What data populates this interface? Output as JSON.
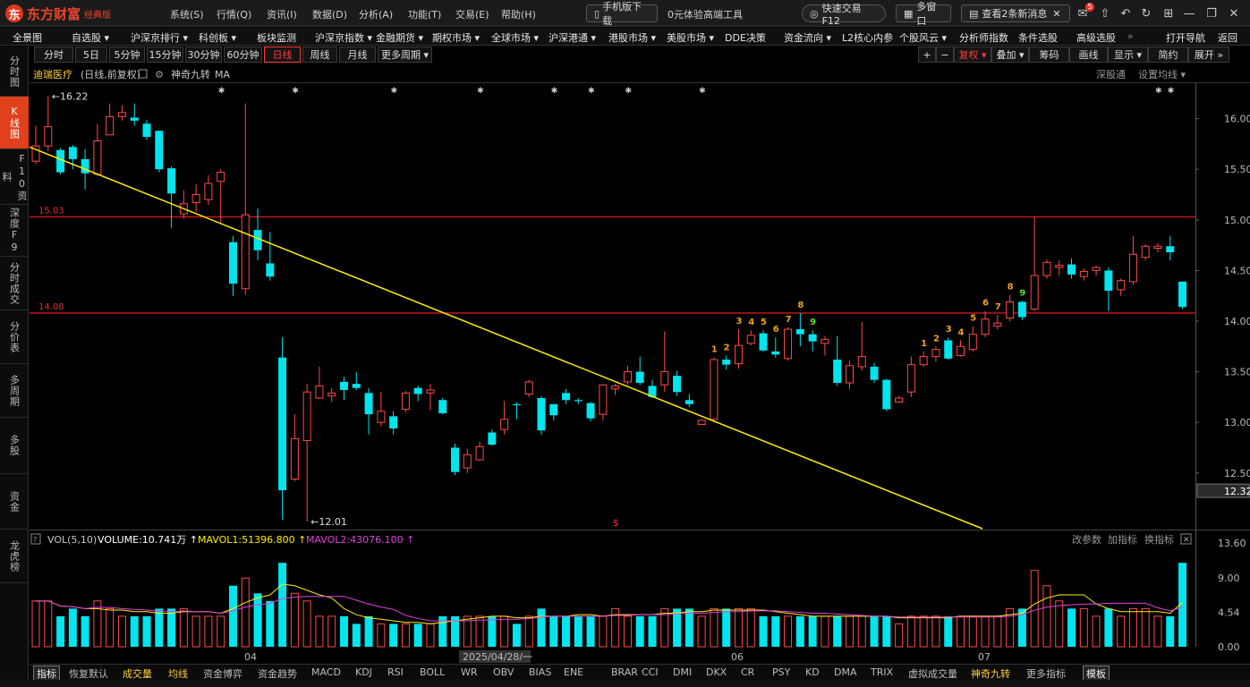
{
  "app": {
    "logo_text": "东方财富",
    "edition": "经典版",
    "menus": [
      "系统(S)",
      "行情(Q)",
      "资讯(I)",
      "数据(D)",
      "分析(A)",
      "功能(T)",
      "交易(E)",
      "帮助(H)"
    ],
    "mobile_btn": "手机版下载",
    "trial_btn": "0元体验高端工具",
    "quick_trade": "快速交易F12",
    "multi_window": "多窗口",
    "news_btn": "查看2条新消息",
    "mail_badge": "5"
  },
  "nav": {
    "items": [
      "全景图",
      "自选股",
      "沪深京排行",
      "科创板",
      "板块监测",
      "沪深京指数",
      "金融期货",
      "期权市场",
      "全球市场",
      "沪深港通",
      "港股市场",
      "美股市场",
      "DDE决策",
      "资金流向",
      "L2核心内参",
      "个股风云",
      "分析师指数",
      "条件选股",
      "高级选股"
    ],
    "open_nav": "打开导航",
    "back": "返回"
  },
  "sidebar": {
    "items": [
      "分时图",
      "K线图",
      "F10资料",
      "深度F9",
      "分时成交",
      "分价表",
      "多周期",
      "多股",
      "资金",
      "龙虎榜"
    ],
    "active_index": 1
  },
  "periods": {
    "items": [
      "分时",
      "5日",
      "5分钟",
      "15分钟",
      "30分钟",
      "60分钟",
      "日线",
      "周线",
      "月线",
      "更多周期"
    ],
    "selected": "日线",
    "right_buttons": [
      "复权",
      "叠加",
      "筹码",
      "画线",
      "显示",
      "简约",
      "展开"
    ]
  },
  "stock": {
    "name": "迪瑞医疗",
    "mode": "(日线,前复权)",
    "indicator": "神奇九转",
    "ma": "MA",
    "sg_link": "深股通",
    "ma_setting": "设置均线"
  },
  "price_chart": {
    "y_ticks": [
      "16.00",
      "15.50",
      "15.00",
      "14.50",
      "14.00",
      "13.50",
      "13.00",
      "12.50"
    ],
    "current_price": "12.32",
    "high_label": "16.22",
    "low_label": "12.01",
    "hline_upper": "15.03",
    "hline_lower": "14.08",
    "x_labels": [
      "04",
      "2025/04/28/一",
      "06",
      "07"
    ],
    "nine_turn_labels": [
      "1",
      "2",
      "3",
      "4",
      "5",
      "6",
      "7",
      "8",
      "9"
    ],
    "colors": {
      "up": "#ff4a4a",
      "down": "#00e5ee",
      "hline": "#d01818",
      "trend": "#ffee00"
    }
  },
  "volume": {
    "title": "VOL(5,10)",
    "volume_label": "VOLUME:10.741万",
    "mavol1": "MAVOL1:51396.800",
    "mavol2": "MAVOL2:43076.100",
    "links": [
      "改参数",
      "加指标",
      "换指标"
    ],
    "y_ticks": [
      "13.60",
      "9.00",
      "4.54",
      "0.00"
    ]
  },
  "indicator_tabs": [
    "指标",
    "恢复默认",
    "成交量",
    "均线",
    "资金博弈",
    "资金趋势",
    "MACD",
    "KDJ",
    "RSI",
    "BOLL",
    "WR",
    "OBV",
    "BIAS",
    "ENE",
    "BRAR",
    "CCI",
    "DMI",
    "DKX",
    "CR",
    "PSY",
    "KD",
    "DMA",
    "TRIX",
    "虚拟成交量",
    "神奇九转",
    "更多指标",
    "模板"
  ],
  "chart_data": {
    "type": "candlestick",
    "ylim": [
      11.95,
      16.35
    ],
    "candles": [
      [
        15.58,
        15.73,
        15.93,
        15.55
      ],
      [
        15.73,
        15.92,
        16.22,
        15.68
      ],
      [
        15.69,
        15.47,
        15.71,
        15.45
      ],
      [
        15.72,
        15.6,
        15.74,
        15.5
      ],
      [
        15.6,
        15.46,
        15.7,
        15.3
      ],
      [
        15.45,
        15.78,
        15.95,
        15.43
      ],
      [
        15.84,
        16.02,
        16.15,
        15.84
      ],
      [
        16.02,
        16.06,
        16.13,
        15.98
      ],
      [
        16.01,
        15.98,
        16.15,
        15.93
      ],
      [
        15.95,
        15.82,
        15.99,
        15.79
      ],
      [
        15.88,
        15.5,
        15.88,
        15.47
      ],
      [
        15.51,
        15.26,
        15.53,
        14.92
      ],
      [
        15.06,
        15.16,
        15.29,
        15.01
      ],
      [
        15.17,
        15.25,
        15.35,
        15.08
      ],
      [
        15.2,
        15.36,
        15.44,
        15.15
      ],
      [
        15.38,
        15.47,
        15.5,
        14.97
      ],
      [
        14.78,
        14.37,
        14.84,
        14.25
      ],
      [
        14.32,
        15.05,
        16.15,
        14.26
      ],
      [
        14.9,
        14.7,
        15.11,
        14.6
      ],
      [
        14.57,
        14.44,
        14.88,
        14.4
      ],
      [
        13.64,
        12.33,
        13.84,
        12.04
      ],
      [
        12.44,
        12.84,
        13.08,
        12.42
      ],
      [
        12.82,
        13.3,
        13.38,
        12.02
      ],
      [
        13.24,
        13.36,
        13.55,
        13.23
      ],
      [
        13.26,
        13.29,
        13.34,
        13.2
      ],
      [
        13.4,
        13.32,
        13.45,
        13.22
      ],
      [
        13.38,
        13.34,
        13.5,
        13.32
      ],
      [
        13.29,
        13.08,
        13.34,
        12.88
      ],
      [
        13.0,
        13.11,
        13.3,
        12.96
      ],
      [
        13.06,
        12.94,
        13.11,
        12.88
      ],
      [
        13.13,
        13.29,
        13.31,
        13.1
      ],
      [
        13.34,
        13.28,
        13.36,
        13.21
      ],
      [
        13.29,
        13.32,
        13.38,
        13.12
      ],
      [
        13.22,
        13.09,
        13.24,
        13.08
      ],
      [
        12.75,
        12.51,
        12.79,
        12.48
      ],
      [
        12.55,
        12.68,
        12.74,
        12.5
      ],
      [
        12.63,
        12.76,
        12.81,
        12.62
      ],
      [
        12.9,
        12.78,
        12.93,
        12.77
      ],
      [
        12.93,
        13.03,
        13.21,
        12.88
      ],
      [
        13.18,
        13.17,
        13.2,
        13.03
      ],
      [
        13.28,
        13.4,
        13.42,
        13.25
      ],
      [
        13.24,
        12.92,
        13.26,
        12.88
      ],
      [
        13.18,
        13.07,
        13.1,
        13.02
      ],
      [
        13.29,
        13.22,
        13.33,
        13.18
      ],
      [
        13.22,
        13.21,
        13.24,
        13.18
      ],
      [
        13.19,
        13.04,
        13.2,
        13.01
      ],
      [
        13.08,
        13.37,
        13.38,
        13.02
      ],
      [
        13.33,
        13.36,
        13.38,
        13.27
      ],
      [
        13.4,
        13.5,
        13.56,
        13.37
      ],
      [
        13.5,
        13.39,
        13.65,
        13.37
      ],
      [
        13.36,
        13.25,
        13.42,
        13.24
      ],
      [
        13.37,
        13.5,
        13.9,
        13.3
      ],
      [
        13.46,
        13.3,
        13.51,
        13.26
      ],
      [
        13.22,
        13.18,
        13.28,
        13.15
      ],
      [
        12.98,
        13.02,
        13.03,
        13.0
      ],
      [
        13.03,
        13.62,
        13.64,
        13.0
      ],
      [
        13.62,
        13.57,
        13.66,
        13.52
      ],
      [
        13.58,
        13.76,
        13.92,
        13.53
      ],
      [
        13.78,
        13.86,
        13.91,
        13.76
      ],
      [
        13.88,
        13.71,
        13.91,
        13.7
      ],
      [
        13.7,
        13.67,
        13.84,
        13.64
      ],
      [
        13.63,
        13.92,
        13.94,
        13.61
      ],
      [
        13.92,
        13.87,
        14.08,
        13.75
      ],
      [
        13.87,
        13.8,
        13.91,
        13.7
      ],
      [
        13.78,
        13.82,
        13.85,
        13.66
      ],
      [
        13.62,
        13.39,
        13.85,
        13.36
      ],
      [
        13.39,
        13.56,
        13.61,
        13.33
      ],
      [
        13.55,
        13.65,
        13.99,
        13.51
      ],
      [
        13.55,
        13.42,
        13.59,
        13.39
      ],
      [
        13.42,
        13.13,
        13.43,
        13.11
      ],
      [
        13.2,
        13.24,
        13.26,
        13.2
      ],
      [
        13.3,
        13.57,
        13.65,
        13.25
      ],
      [
        13.57,
        13.65,
        13.7,
        13.55
      ],
      [
        13.65,
        13.72,
        13.75,
        13.6
      ],
      [
        13.81,
        13.63,
        13.84,
        13.62
      ],
      [
        13.66,
        13.75,
        13.81,
        13.65
      ],
      [
        13.72,
        13.87,
        13.95,
        13.7
      ],
      [
        13.87,
        14.02,
        14.1,
        13.84
      ],
      [
        13.95,
        13.98,
        14.06,
        13.92
      ],
      [
        14.03,
        14.19,
        14.26,
        14.0
      ],
      [
        14.19,
        14.04,
        14.2,
        14.01
      ],
      [
        14.12,
        14.45,
        15.03,
        14.1
      ],
      [
        14.45,
        14.58,
        14.61,
        14.42
      ],
      [
        14.53,
        14.55,
        14.6,
        14.45
      ],
      [
        14.56,
        14.46,
        14.62,
        14.42
      ],
      [
        14.44,
        14.49,
        14.52,
        14.4
      ],
      [
        14.5,
        14.53,
        14.55,
        14.45
      ],
      [
        14.5,
        14.3,
        14.53,
        14.1
      ],
      [
        14.31,
        14.4,
        14.42,
        14.25
      ],
      [
        14.39,
        14.66,
        14.84,
        14.36
      ],
      [
        14.63,
        14.74,
        14.76,
        14.6
      ],
      [
        14.72,
        14.74,
        14.77,
        14.68
      ],
      [
        14.74,
        14.68,
        14.84,
        14.6
      ],
      [
        14.39,
        14.14,
        14.39,
        14.12
      ]
    ],
    "volume": [
      6,
      6,
      4,
      5,
      4,
      6,
      5,
      4,
      4,
      4,
      5,
      5,
      5,
      4,
      4,
      4,
      8,
      9,
      7,
      6,
      11,
      7,
      6,
      4,
      4,
      4,
      3,
      4,
      3,
      3,
      3,
      3,
      3,
      4,
      4,
      4,
      4,
      4,
      4,
      3,
      4,
      5,
      4,
      4,
      4,
      4,
      4,
      5,
      4,
      4,
      4,
      5,
      5,
      5,
      4,
      5,
      5,
      5,
      5,
      4,
      4,
      4,
      4,
      4,
      4,
      4,
      4,
      4,
      4,
      4,
      3,
      4,
      4,
      4,
      4,
      4,
      4,
      4,
      4,
      5,
      5,
      10,
      8,
      6,
      5,
      5,
      4,
      5,
      4,
      5,
      5,
      4,
      4,
      11
    ]
  }
}
